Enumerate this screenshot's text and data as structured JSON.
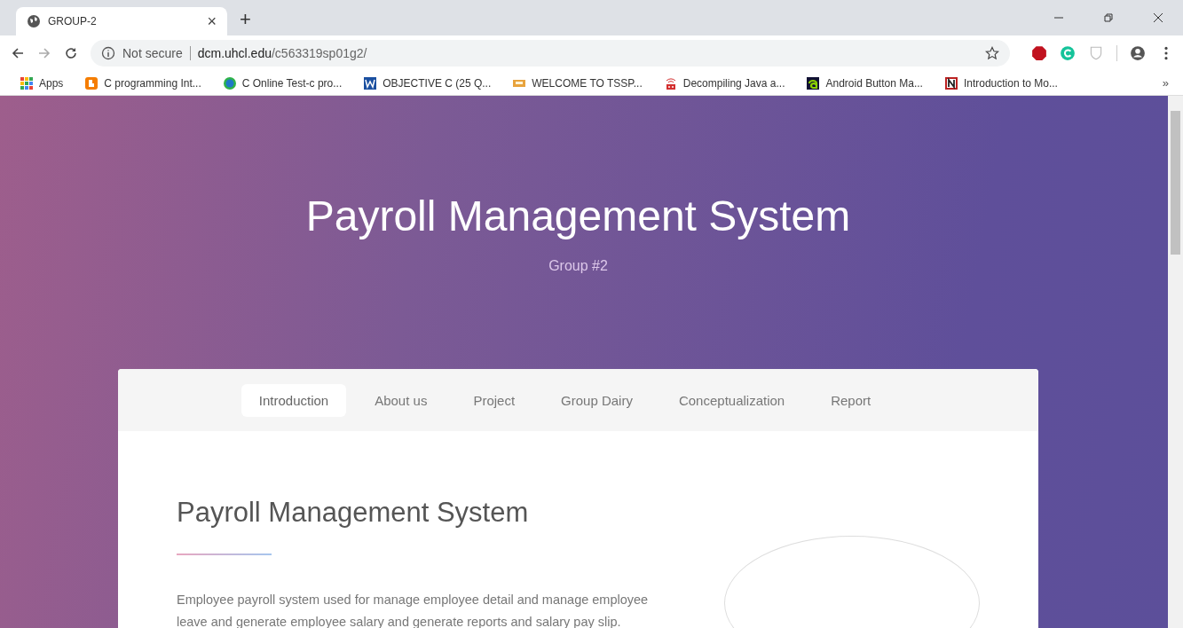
{
  "browser": {
    "tab": {
      "title": "GROUP-2",
      "close": "×"
    },
    "new_tab": "+",
    "address": {
      "security": "Not secure",
      "host": "dcm.uhcl.edu",
      "path": "/c563319sp01g2/"
    },
    "bookmarks": [
      {
        "label": "Apps",
        "kind": "apps"
      },
      {
        "label": "C programming Int...",
        "kind": "blogger"
      },
      {
        "label": "C Online Test-c pro...",
        "kind": "circle"
      },
      {
        "label": "OBJECTIVE C (25 Q...",
        "kind": "word"
      },
      {
        "label": "WELCOME TO TSSP...",
        "kind": "card"
      },
      {
        "label": "Decompiling Java a...",
        "kind": "robot"
      },
      {
        "label": "Android Button Ma...",
        "kind": "letter"
      },
      {
        "label": "Introduction to Mo...",
        "kind": "news"
      }
    ],
    "more": "»"
  },
  "hero": {
    "title": "Payroll Management System",
    "subtitle": "Group #2"
  },
  "nav": [
    {
      "label": "Introduction",
      "selected": true
    },
    {
      "label": "About us",
      "selected": false
    },
    {
      "label": "Project",
      "selected": false
    },
    {
      "label": "Group Dairy",
      "selected": false
    },
    {
      "label": "Conceptualization",
      "selected": false
    },
    {
      "label": "Report",
      "selected": false
    }
  ],
  "section": {
    "heading": "Payroll Management System",
    "text": "Employee payroll system used for manage employee detail and manage employee leave and generate employee salary and generate reports and salary pay slip."
  }
}
